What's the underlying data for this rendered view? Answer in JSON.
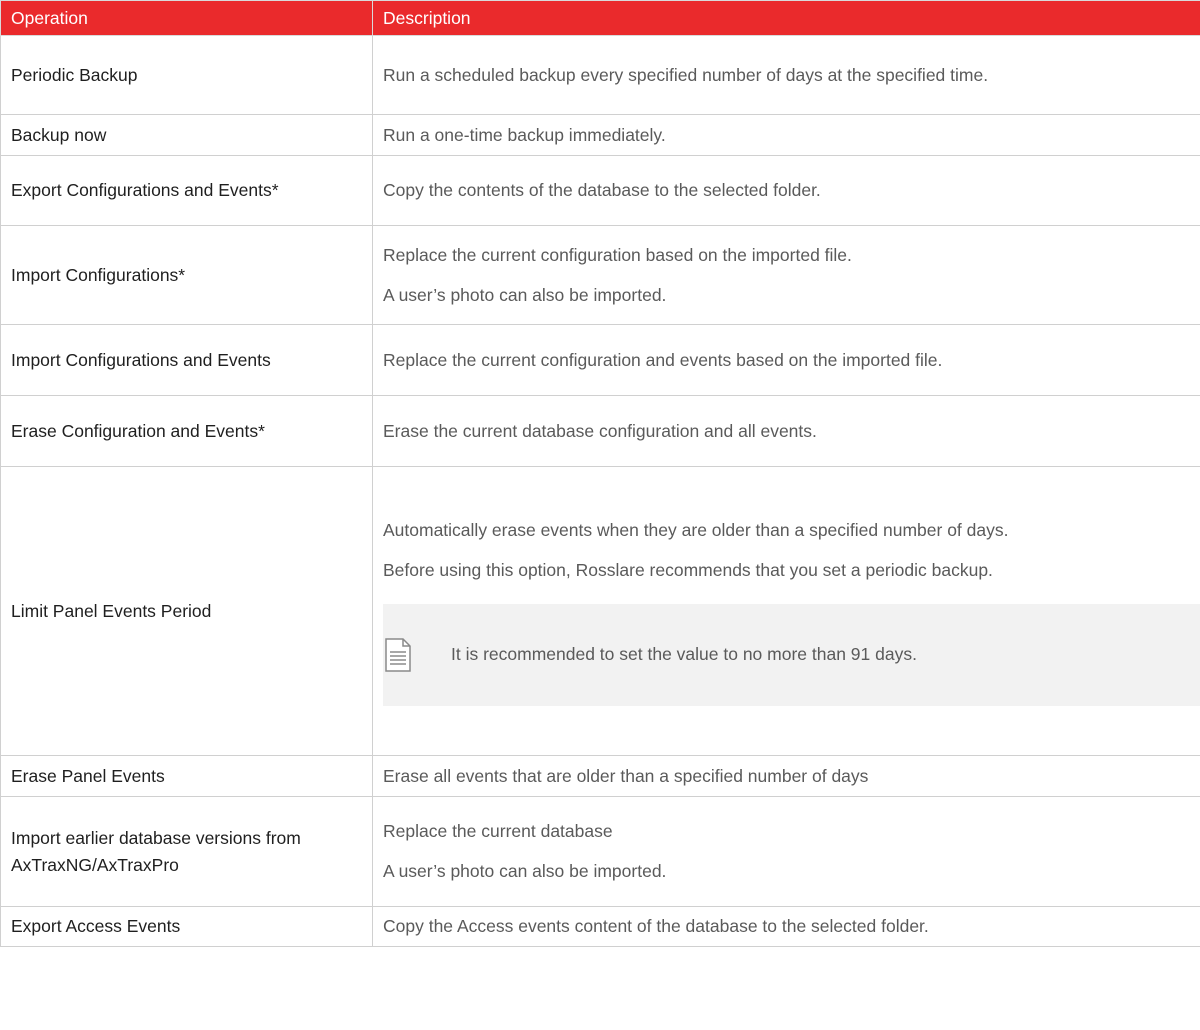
{
  "table": {
    "headers": {
      "operation": "Operation",
      "description": "Description"
    },
    "rows": [
      {
        "operation": "Periodic Backup",
        "description": [
          "Run a scheduled backup every specified number of days at the specified time."
        ]
      },
      {
        "operation": "Backup now",
        "description": [
          "Run a one-time backup immediately."
        ]
      },
      {
        "operation": "Export Configurations and Events*",
        "description": [
          "Copy the contents of the database to the selected folder."
        ]
      },
      {
        "operation": "Import Configurations*",
        "description": [
          "Replace the current configuration based on the imported file.",
          "A user’s photo can also be imported."
        ]
      },
      {
        "operation": "Import Configurations and Events",
        "description": [
          "Replace the current configuration and events based on the imported file."
        ]
      },
      {
        "operation": "Erase Configuration and Events*",
        "description": [
          "Erase the current database configuration and all events."
        ]
      },
      {
        "operation": "Limit Panel Events Period",
        "description": [
          "Automatically erase events when they are older than a specified number of days.",
          "Before using this option, Rosslare recommends that you set a periodic backup."
        ],
        "note": "It is recommended to set the value to no more than 91 days.",
        "note_icon": "document-note-icon"
      },
      {
        "operation": "Erase Panel Events",
        "description": [
          "Erase all events that are older than a specified number of days"
        ]
      },
      {
        "operation": "Import earlier database versions from AxTraxNG/AxTraxPro",
        "description": [
          "Replace the current database",
          "A user’s photo can also be imported."
        ]
      },
      {
        "operation": "Export Access Events",
        "description": [
          "Copy the Access events content of the database to the selected folder."
        ]
      }
    ]
  },
  "colors": {
    "header_bg": "#ea2a2c",
    "header_text": "#ffffff",
    "border": "#d0d0d0",
    "note_bg": "#f2f2f2"
  }
}
